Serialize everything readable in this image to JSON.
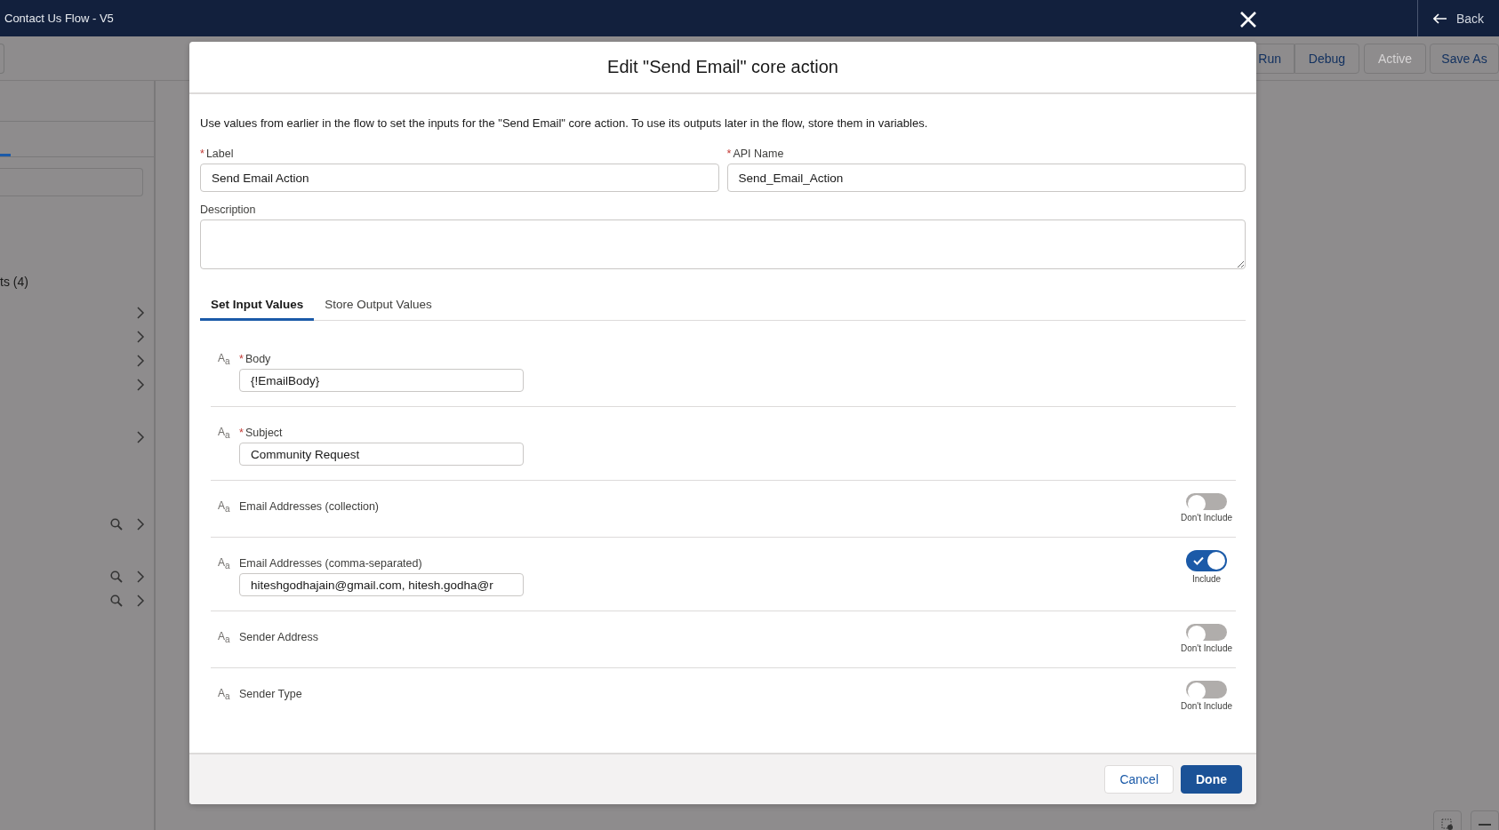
{
  "window": {
    "title": "Contact Us Flow - V5",
    "back": "Back"
  },
  "toolbar": {
    "buttons": [
      {
        "label": "Run",
        "disabled": false
      },
      {
        "label": "Debug",
        "disabled": false
      },
      {
        "label": "Active",
        "disabled": true
      },
      {
        "label": "Save As",
        "disabled": false
      }
    ]
  },
  "sidebar": {
    "section_label": "ts (4)",
    "rows": [
      {
        "search": false
      },
      {
        "search": false
      },
      {
        "search": false
      },
      {
        "search": false
      },
      {
        "search": false
      },
      {
        "search": true
      },
      {
        "search": true
      },
      {
        "search": true
      }
    ]
  },
  "modal": {
    "title": "Edit \"Send Email\" core action",
    "intro": "Use values from earlier in the flow to set the inputs for the \"Send Email\" core action. To use its outputs later in the flow, store them in variables.",
    "fields": [
      {
        "label": "Label",
        "required_mark": "*",
        "value": "Send Email Action"
      },
      {
        "label": "API Name",
        "required_mark": "*",
        "value": "Send_Email_Action"
      }
    ],
    "description": {
      "label": "Description"
    },
    "tabs": [
      {
        "label": "Set Input Values",
        "selected": true
      },
      {
        "label": "Store Output Values",
        "selected": false
      }
    ],
    "params": [
      {
        "type_icon": "A$_{a}$",
        "label": "Body",
        "required_mark": "*",
        "value": "{!EmailBody}"
      },
      {
        "type_icon": "A$_{a}$",
        "label": "Subject",
        "required_mark": "*",
        "value": "Community Request"
      },
      {
        "type_icon": "A$_{a}$",
        "label": "Email Addresses (collection)",
        "toggle": {
          "on": false,
          "caption": "Don't Include"
        }
      },
      {
        "type_icon": "A$_{a}$",
        "label": "Email Addresses (comma-separated)",
        "value": "hiteshgodhajain@gmail.com, hitesh.godha@r",
        "toggle": {
          "on": true,
          "caption": "Include"
        }
      },
      {
        "type_icon": "A$_{a}$",
        "label": "Sender Address",
        "toggle": {
          "on": false,
          "caption": "Don't Include"
        }
      },
      {
        "type_icon": "A$_{a}$",
        "label": "Sender Type",
        "toggle": {
          "on": false,
          "caption": "Don't Include"
        }
      }
    ],
    "buttons": [
      {
        "label": "Cancel",
        "kind": "neutral"
      },
      {
        "label": "Done",
        "kind": "brand"
      }
    ]
  }
}
